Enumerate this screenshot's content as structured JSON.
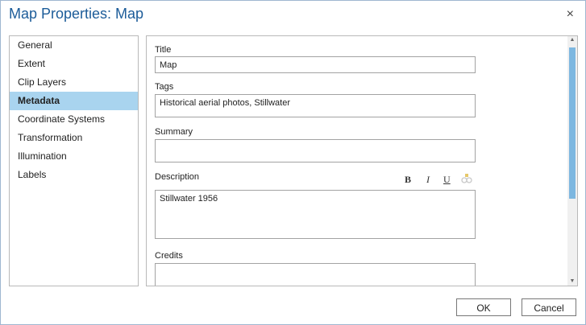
{
  "dialog": {
    "title": "Map Properties: Map",
    "close_icon": "×"
  },
  "nav": {
    "items": [
      {
        "label": "General"
      },
      {
        "label": "Extent"
      },
      {
        "label": "Clip Layers"
      },
      {
        "label": "Metadata",
        "active": true
      },
      {
        "label": "Coordinate Systems"
      },
      {
        "label": "Transformation"
      },
      {
        "label": "Illumination"
      },
      {
        "label": "Labels"
      }
    ]
  },
  "metadata": {
    "title_label": "Title",
    "title_value": "Map",
    "tags_label": "Tags",
    "tags_value": "Historical aerial photos, Stillwater",
    "summary_label": "Summary",
    "summary_value": "",
    "description_label": "Description",
    "description_value": "Stillwater 1956",
    "credits_label": "Credits",
    "credits_value": "",
    "format_bold": "B",
    "format_italic": "I",
    "format_underline": "U",
    "format_link_icon": "link-icon"
  },
  "buttons": {
    "ok": "OK",
    "cancel": "Cancel"
  },
  "colors": {
    "title": "#1c5c99",
    "active_nav": "#a9d4ef",
    "scroll_thumb": "#7db7e0"
  }
}
